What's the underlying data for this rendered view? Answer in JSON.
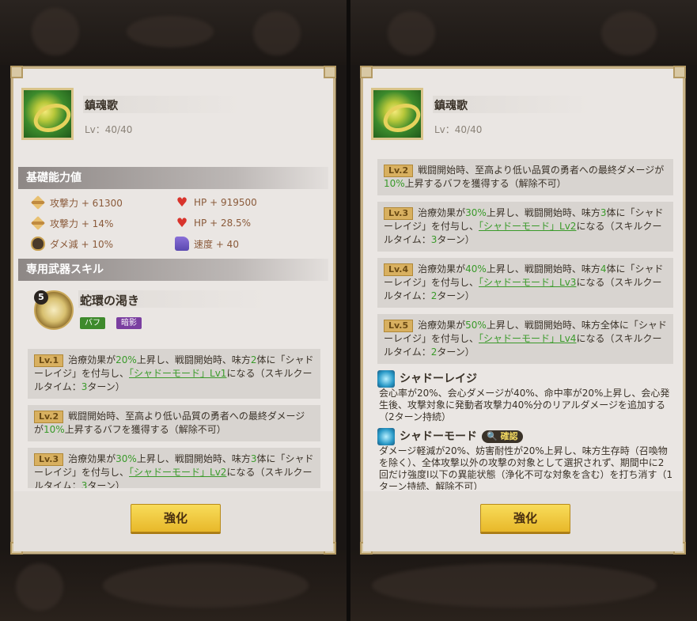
{
  "colors": {
    "accent_green": "#3a9a2a",
    "button_yellow": "#f0c83a",
    "panel_bg": "#eae6e3"
  },
  "left": {
    "equip": {
      "name": "鎮魂歌",
      "level": "Lv：40/40"
    },
    "base_stats_title": "基礎能力値",
    "stats": [
      {
        "icon": "sword-icon",
        "label": "攻撃力 + 61300"
      },
      {
        "icon": "heart-icon",
        "label": "HP + 919500"
      },
      {
        "icon": "sword-icon",
        "label": "攻撃力 + 14%"
      },
      {
        "icon": "heart-icon",
        "label": "HP + 28.5%"
      },
      {
        "icon": "shield-icon",
        "label": "ダメ減 + 10%"
      },
      {
        "icon": "boot-icon",
        "label": "速度 + 40"
      }
    ],
    "skill_section_title": "専用武器スキル",
    "skill": {
      "badge": "5",
      "name": "蛇環の渇き",
      "tag_buff": "バフ",
      "tag_dark": "暗影"
    },
    "levels": [
      {
        "tag": "Lv.1",
        "p1": "治療効果が",
        "v1": "20%",
        "p2": "上昇し、戦闘開始時、味方",
        "v2": "2",
        "p3": "体に「シャドーレイジ」を付与し、",
        "link": "「シャドーモード」Lv1",
        "p4": "になる（スキルクールタイム：",
        "v3": "3",
        "p5": "ターン）"
      },
      {
        "tag": "Lv.2",
        "p1": "戦闘開始時、至高より低い品質の勇者への最終ダメージが",
        "v1": "10%",
        "p2": "上昇するバフを獲得する（解除不可）"
      },
      {
        "tag": "Lv.3",
        "p1": "治療効果が",
        "v1": "30%",
        "p2": "上昇し、戦闘開始時、味方",
        "v2": "3",
        "p3": "体に「シャドーレイジ」を付与し、",
        "link": "「シャドーモード」Lv2",
        "p4": "になる（スキルクールタイム：",
        "v3": "3",
        "p5": "ターン）"
      }
    ],
    "button": "強化"
  },
  "right": {
    "equip": {
      "name": "鎮魂歌",
      "level": "Lv：40/40"
    },
    "levels": [
      {
        "tag": "Lv.2",
        "p1": "戦闘開始時、至高より低い品質の勇者への最終ダメージが",
        "v1": "10%",
        "p2": "上昇するバフを獲得する（解除不可）"
      },
      {
        "tag": "Lv.3",
        "p1": "治療効果が",
        "v1": "30%",
        "p2": "上昇し、戦闘開始時、味方",
        "v2": "3",
        "p3": "体に「シャドーレイジ」を付与し、",
        "link": "「シャドーモード」Lv2",
        "p4": "になる（スキルクールタイム：",
        "v3": "3",
        "p5": "ターン）"
      },
      {
        "tag": "Lv.4",
        "p1": "治療効果が",
        "v1": "40%",
        "p2": "上昇し、戦闘開始時、味方",
        "v2": "4",
        "p3": "体に「シャドーレイジ」を付与し、",
        "link": "「シャドーモード」Lv3",
        "p4": "になる（スキルクールタイム：",
        "v3": "2",
        "p5": "ターン）"
      },
      {
        "tag": "Lv.5",
        "p1": "治療効果が",
        "v1": "50%",
        "p2": "上昇し、戦闘開始時、味方全体に「シャドーレイジ」を付与し、",
        "link": "「シャドーモード」Lv4",
        "p4": "になる（スキルクールタイム：",
        "v3": "2",
        "p5": "ターン）"
      }
    ],
    "effects": [
      {
        "icon": "shadow-rage-icon",
        "name": "シャドーレイジ",
        "desc": "会心率が20%、会心ダメージが40%、命中率が20%上昇し、会心発生後、攻撃対象に発動者攻撃力40%分のリアルダメージを追加する（2ターン持続）"
      },
      {
        "icon": "shadow-mode-icon",
        "name": "シャドーモード",
        "chip": "確認",
        "desc": "ダメージ軽減が20%、妨害耐性が20%上昇し、味方生存時（召喚物を除く）、全体攻撃以外の攻撃の対象として選択されず、期間中に2回だけ強度Ⅰ以下の異能状態（浄化不可な対象を含む）を打ち消す（1ターン持続、解除不可）"
      }
    ],
    "button": "強化"
  }
}
